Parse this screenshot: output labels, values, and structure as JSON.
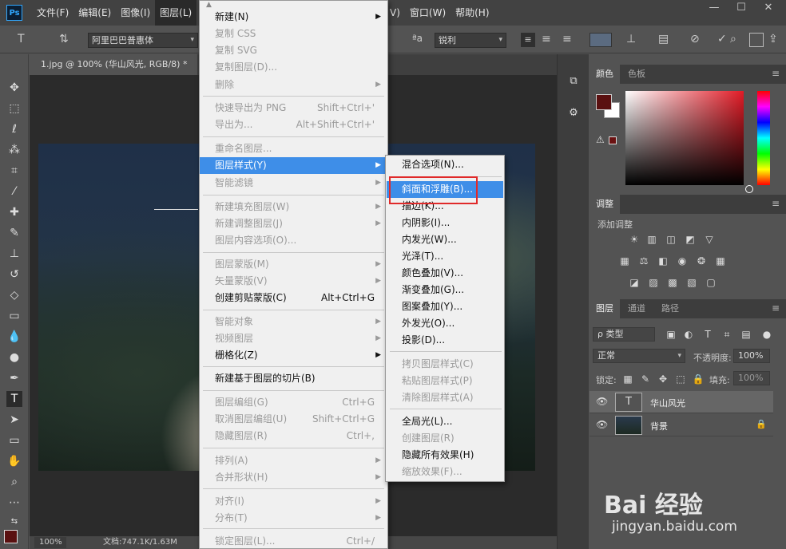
{
  "menubar": {
    "logo": "Ps",
    "items": [
      "文件(F)",
      "编辑(E)",
      "图像(I)",
      "图层(L)"
    ],
    "items_right": [
      "V)",
      "窗口(W)",
      "帮助(H)"
    ],
    "window_controls": [
      "—",
      "☐",
      "✕"
    ]
  },
  "options": {
    "font_family": "阿里巴巴普惠体",
    "aa_label": "ªa",
    "aa_value": "锐利"
  },
  "document": {
    "tab_title": "1.jpg @ 100% (华山风光, RGB/8) *",
    "zoom": "100%",
    "info": "文档:747.1K/1.63M"
  },
  "layer_menu": {
    "items": [
      {
        "label": "新建(N)",
        "arrow": true
      },
      {
        "label": "复制 CSS",
        "disabled": true
      },
      {
        "label": "复制 SVG",
        "disabled": true
      },
      {
        "label": "复制图层(D)...",
        "disabled": true
      },
      {
        "label": "删除",
        "disabled": true,
        "arrow": true
      },
      {
        "label": "快速导出为 PNG",
        "disabled": true,
        "shortcut": "Shift+Ctrl+'"
      },
      {
        "label": "导出为...",
        "disabled": true,
        "shortcut": "Alt+Shift+Ctrl+'"
      },
      {
        "label": "重命名图层...",
        "disabled": true
      },
      {
        "label": "图层样式(Y)",
        "highlight": true,
        "arrow": true
      },
      {
        "label": "智能滤镜",
        "disabled": true,
        "arrow": true
      },
      {
        "label": "新建填充图层(W)",
        "disabled": true,
        "arrow": true
      },
      {
        "label": "新建调整图层(J)",
        "disabled": true,
        "arrow": true
      },
      {
        "label": "图层内容选项(O)...",
        "disabled": true
      },
      {
        "label": "图层蒙版(M)",
        "disabled": true,
        "arrow": true
      },
      {
        "label": "矢量蒙版(V)",
        "disabled": true,
        "arrow": true
      },
      {
        "label": "创建剪贴蒙版(C)",
        "shortcut": "Alt+Ctrl+G"
      },
      {
        "label": "智能对象",
        "disabled": true,
        "arrow": true
      },
      {
        "label": "视频图层",
        "disabled": true,
        "arrow": true
      },
      {
        "label": "栅格化(Z)",
        "arrow": true
      },
      {
        "label": "新建基于图层的切片(B)"
      },
      {
        "label": "图层编组(G)",
        "disabled": true,
        "shortcut": "Ctrl+G"
      },
      {
        "label": "取消图层编组(U)",
        "disabled": true,
        "shortcut": "Shift+Ctrl+G"
      },
      {
        "label": "隐藏图层(R)",
        "disabled": true,
        "shortcut": "Ctrl+,"
      },
      {
        "label": "排列(A)",
        "disabled": true,
        "arrow": true
      },
      {
        "label": "合并形状(H)",
        "disabled": true,
        "arrow": true
      },
      {
        "label": "对齐(I)",
        "disabled": true,
        "arrow": true
      },
      {
        "label": "分布(T)",
        "disabled": true,
        "arrow": true
      },
      {
        "label": "锁定图层(L)...",
        "disabled": true,
        "shortcut": "Ctrl+/"
      }
    ]
  },
  "style_menu": {
    "items": [
      {
        "label": "混合选项(N)..."
      },
      {
        "label": "斜面和浮雕(B)...",
        "highlight": true
      },
      {
        "label": "描边(K)..."
      },
      {
        "label": "内阴影(I)..."
      },
      {
        "label": "内发光(W)..."
      },
      {
        "label": "光泽(T)..."
      },
      {
        "label": "颜色叠加(V)..."
      },
      {
        "label": "渐变叠加(G)..."
      },
      {
        "label": "图案叠加(Y)..."
      },
      {
        "label": "外发光(O)..."
      },
      {
        "label": "投影(D)..."
      },
      {
        "label": "拷贝图层样式(C)",
        "disabled": true
      },
      {
        "label": "粘贴图层样式(P)",
        "disabled": true
      },
      {
        "label": "清除图层样式(A)",
        "disabled": true
      },
      {
        "label": "全局光(L)..."
      },
      {
        "label": "创建图层(R)",
        "disabled": true
      },
      {
        "label": "隐藏所有效果(H)"
      },
      {
        "label": "缩放效果(F)...",
        "disabled": true
      }
    ]
  },
  "color_panel": {
    "tabs": [
      "颜色",
      "色板"
    ],
    "fg_color": "#5a1010",
    "bg_color": "#ffffff"
  },
  "adjust_panel": {
    "tab": "调整",
    "label": "添加调整"
  },
  "layers_panel": {
    "tabs": [
      "图层",
      "通道",
      "路径"
    ],
    "filter": "ρ 类型",
    "blend_mode": "正常",
    "opacity_label": "不透明度:",
    "opacity": "100%",
    "lock_label": "锁定:",
    "fill_label": "填充:",
    "fill": "100%",
    "layers": [
      {
        "name": "华山风光",
        "thumb": "T",
        "active": true
      },
      {
        "name": "背景",
        "thumb": "",
        "locked": true
      }
    ]
  },
  "watermark": {
    "brand": "Bai 经验",
    "url": "jingyan.baidu.com"
  }
}
